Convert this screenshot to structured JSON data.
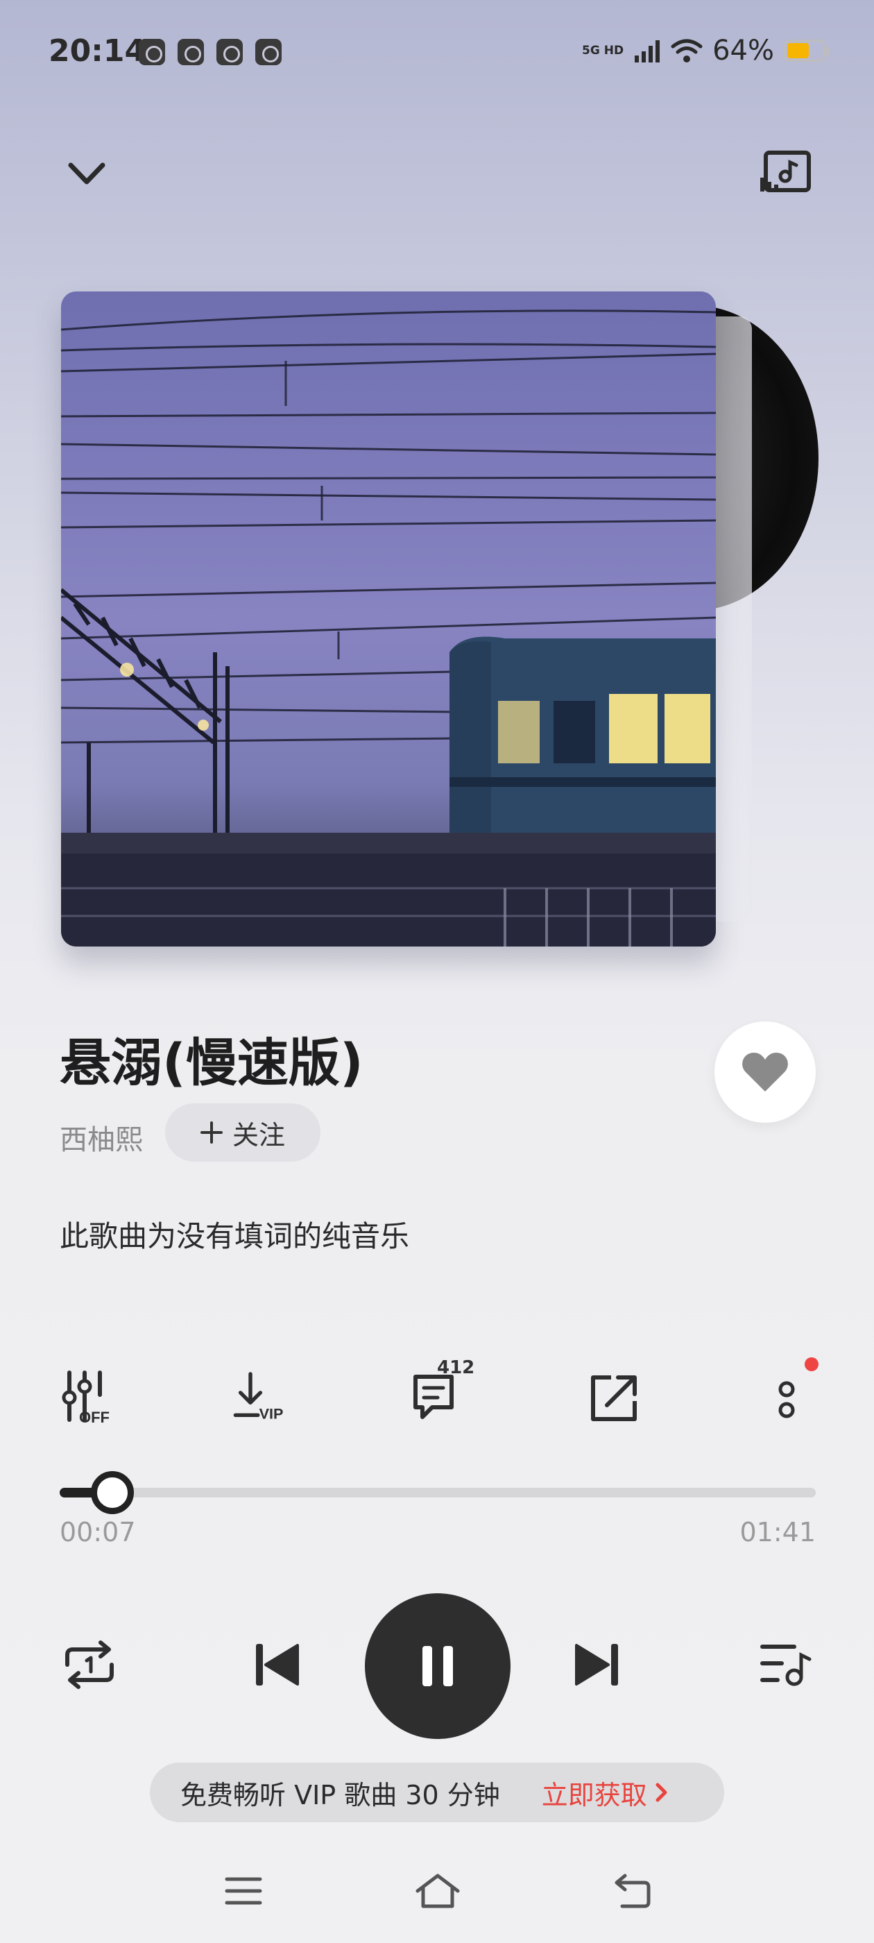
{
  "status_bar": {
    "time": "20:14",
    "network": "5G HD",
    "battery": "64%",
    "battery_level": 0.64,
    "app_icons": [
      "notification-app-1-icon",
      "notification-app-2-icon",
      "notification-app-3-icon",
      "notification-app-4-icon"
    ]
  },
  "header": {
    "collapse_icon": "chevron-down-icon",
    "cast_icon": "cast-device-icon"
  },
  "song": {
    "title": "悬溺(慢速版)",
    "artist": "西柚熙",
    "follow_label": "关注",
    "lyric_note": "此歌曲为没有填词的纯音乐",
    "liked": true
  },
  "actions": {
    "equalizer_label": "OFF",
    "download_label": "VIP",
    "comment_count": "412",
    "more_has_badge": true
  },
  "progress": {
    "current": "00:07",
    "total": "01:41",
    "fraction": 0.07
  },
  "controls": {
    "repeat_mode": "repeat-one-icon",
    "state": "playing"
  },
  "vip_banner": {
    "text": "免费畅听 VIP 歌曲 30 分钟",
    "cta": "立即获取"
  },
  "colors": {
    "accent_red": "#e8443e",
    "battery_yellow": "#f7b500",
    "primary_dark": "#2e2e2e"
  }
}
